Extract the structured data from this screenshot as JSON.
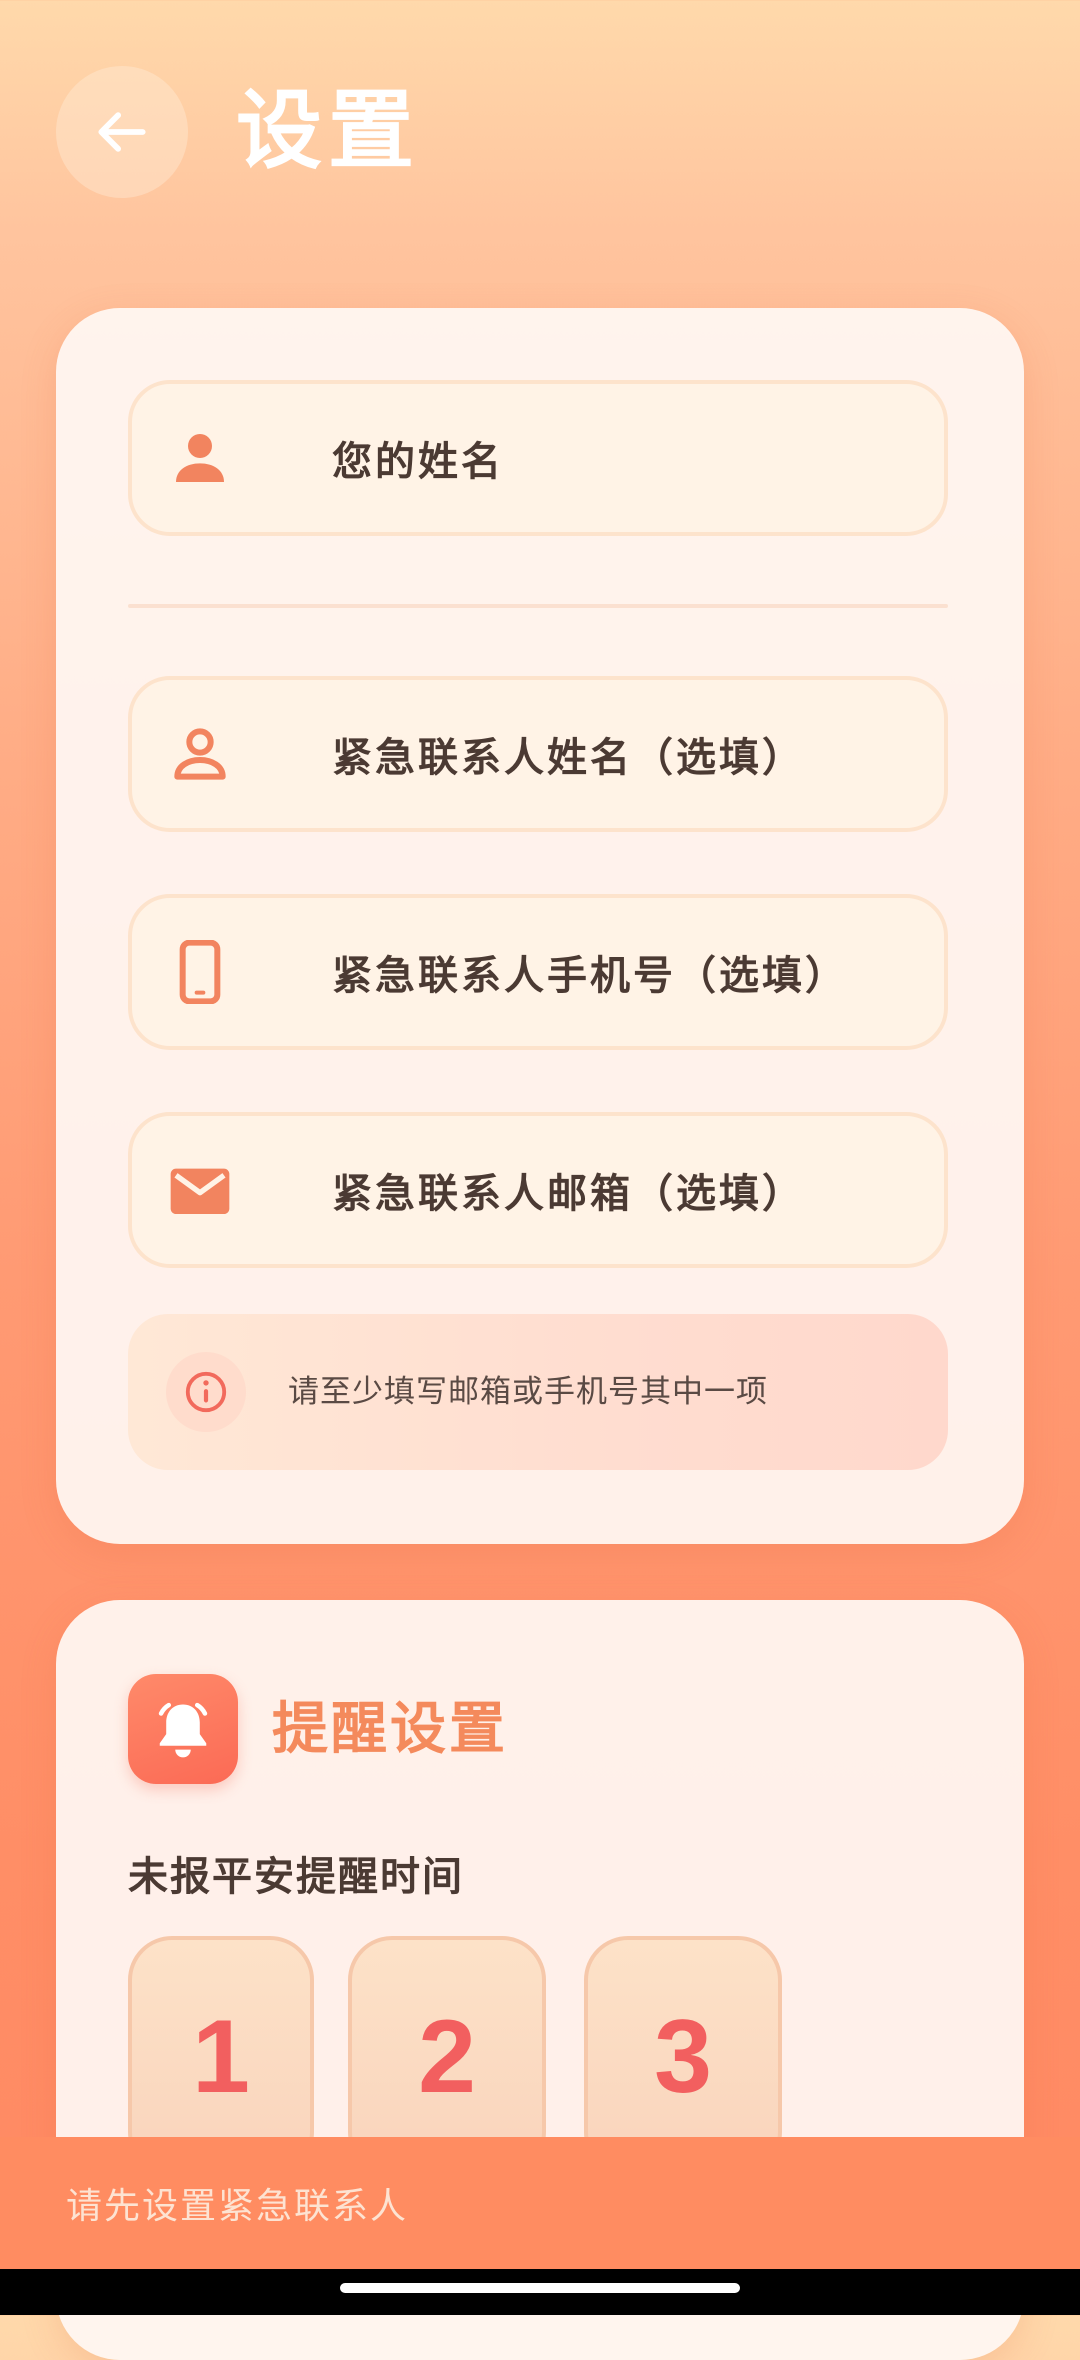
{
  "header": {
    "title": "设置",
    "back_icon": "arrow-left-icon"
  },
  "contact_form": {
    "fields": [
      {
        "label": "您的姓名",
        "icon": "person-filled-icon"
      },
      {
        "label": "紧急联系人姓名（选填）",
        "icon": "person-outline-icon"
      },
      {
        "label": "紧急联系人手机号（选填）",
        "icon": "phone-icon"
      },
      {
        "label": "紧急联系人邮箱（选填）",
        "icon": "mail-icon"
      }
    ],
    "notice": {
      "icon": "info-icon",
      "text": "请至少填写邮箱或手机号其中一项"
    }
  },
  "reminder": {
    "icon": "bell-icon",
    "title": "提醒设置",
    "subtitle": "未报平安提醒时间",
    "day_options": [
      "1",
      "2",
      "3"
    ]
  },
  "toast": {
    "text": "请先设置紧急联系人"
  },
  "colors": {
    "accent": "#f48a5c",
    "icon": "#f2845f",
    "number": "#f25f5f",
    "banner": "#ff8c61"
  }
}
